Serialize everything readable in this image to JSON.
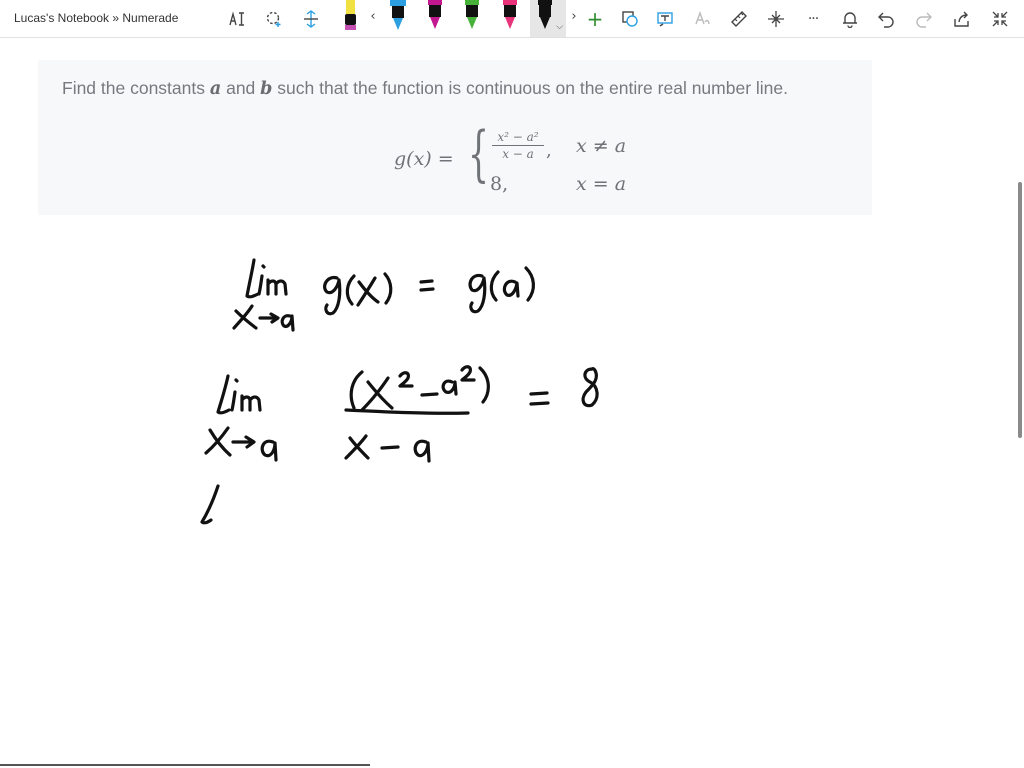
{
  "window": {
    "title": "Lucas's Notebook » Numerade"
  },
  "toolbar": {
    "icons": [
      "text-select-icon",
      "lasso-select-icon",
      "insert-space-icon",
      "more-pens-left-icon",
      "more-pens-right-icon",
      "add-pen-icon",
      "ink-to-shape-icon",
      "ink-to-text-icon",
      "ink-to-math-icon",
      "ruler-icon",
      "touch-writing-icon",
      "more-icon",
      "notification-icon",
      "undo-icon",
      "redo-icon",
      "share-icon",
      "fullscreen-icon"
    ],
    "pens": [
      {
        "name": "highlighter-yellow",
        "color": "#f0e040"
      },
      {
        "name": "pen-blue",
        "color": "#2c9fe0"
      },
      {
        "name": "pen-magenta",
        "color": "#c2188f"
      },
      {
        "name": "pen-green",
        "color": "#46b23a"
      },
      {
        "name": "pen-pink",
        "color": "#e8327a"
      },
      {
        "name": "pen-black",
        "color": "#111111"
      }
    ],
    "more_label": "···",
    "selected_pen": "pen-black"
  },
  "problem": {
    "text_prefix": "Find the constants ",
    "var_a": "a",
    "text_mid": " and ",
    "var_b": "b",
    "text_suffix": " such that the function is continuous on the entire real number line.",
    "formula": {
      "lhs": "g(x) =",
      "case1_numerator": "x² − a²",
      "case1_denominator": "x − a",
      "case1_comma": ",",
      "case1_condition": "x ≠ a",
      "case2_value": "8,",
      "case2_condition": "x = a"
    }
  },
  "ink": {
    "note": "",
    "color": "#111111"
  }
}
